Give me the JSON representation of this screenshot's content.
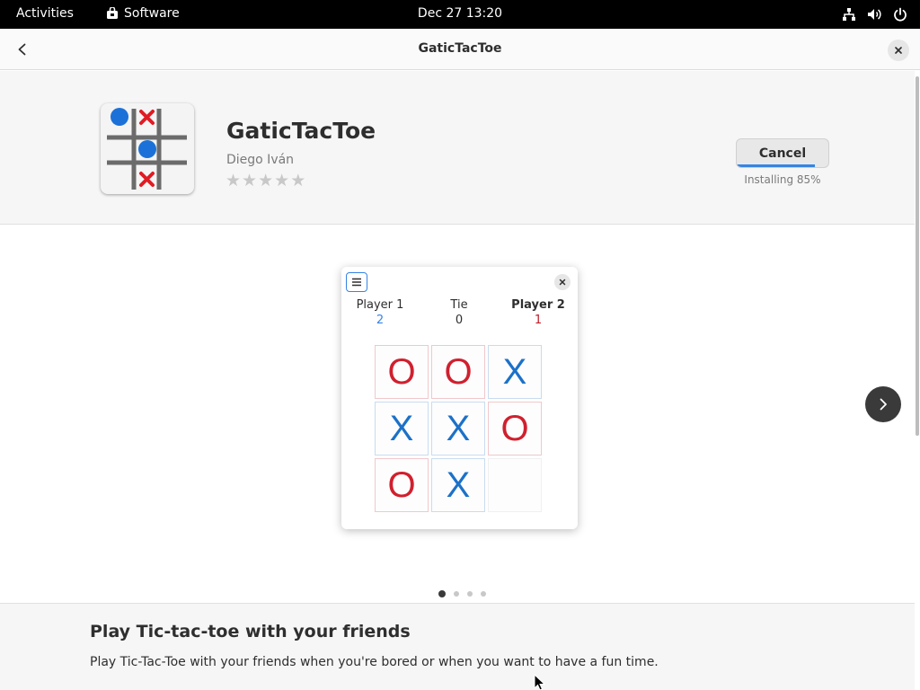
{
  "topbar": {
    "activities": "Activities",
    "app_menu": "Software",
    "clock": "Dec 27  13:20",
    "icons": [
      "network-icon",
      "volume-icon",
      "power-icon"
    ]
  },
  "headerbar": {
    "title": "GaticTacToe",
    "back_icon": "back-arrow-icon",
    "close_icon": "close-icon"
  },
  "app": {
    "name": "GaticTacToe",
    "developer": "Diego Iván",
    "rating": 0,
    "rating_max": 5,
    "cancel_label": "Cancel",
    "install_status": "Installing 85%",
    "install_progress": 0.85
  },
  "screenshot": {
    "player1_label": "Player 1",
    "player1_score": "2",
    "tie_label": "Tie",
    "tie_score": "0",
    "player2_label": "Player 2",
    "player2_score": "1",
    "board": [
      "O",
      "O",
      "X",
      "X",
      "X",
      "O",
      "O",
      "X",
      ""
    ]
  },
  "carousel": {
    "page_count": 4,
    "active_page": 0
  },
  "description": {
    "heading": "Play Tic-tac-toe with your friends",
    "body": "Play Tic-Tac-Toe with your friends when you're bored or when you want to have a fun time."
  },
  "colors": {
    "accent": "#3584e4",
    "o_mark": "#d0202e",
    "x_mark": "#1c71c8",
    "topbar_bg": "#000000"
  }
}
